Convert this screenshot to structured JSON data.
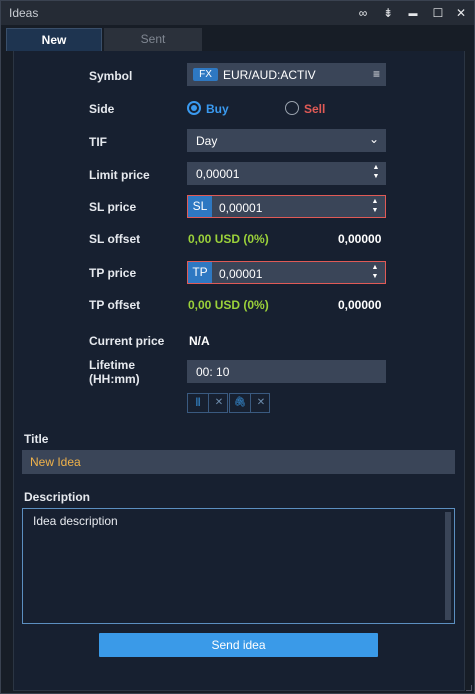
{
  "window": {
    "title": "Ideas",
    "controls": {
      "link_icon": "∞",
      "filter_icon": "⇟",
      "minimize_icon": "▬",
      "maximize_icon": "☐",
      "close_icon": "✕"
    }
  },
  "tabs": [
    {
      "label": "New",
      "active": true
    },
    {
      "label": "Sent",
      "active": false
    }
  ],
  "form": {
    "symbol": {
      "label": "Symbol",
      "badge": "FX",
      "value": "EUR/AUD:ACTIV",
      "menu_icon": "≡"
    },
    "side": {
      "label": "Side",
      "options": [
        {
          "label": "Buy",
          "selected": true,
          "color": "#3a9af0"
        },
        {
          "label": "Sell",
          "selected": false,
          "color": "#e05a56"
        }
      ]
    },
    "tif": {
      "label": "TIF",
      "value": "Day",
      "chevron": "⌄"
    },
    "limit_price": {
      "label": "Limit price",
      "value": "0,00001"
    },
    "sl_price": {
      "label": "SL price",
      "badge": "SL",
      "value": "0,00001"
    },
    "sl_offset": {
      "label": "SL offset",
      "amount": "0,00 USD (0%)",
      "value": "0,00000"
    },
    "tp_price": {
      "label": "TP price",
      "badge": "TP",
      "value": "0,00001"
    },
    "tp_offset": {
      "label": "TP offset",
      "amount": "0,00 USD (0%)",
      "value": "0,00000"
    },
    "current_price": {
      "label": "Current price",
      "value": "N/A"
    },
    "lifetime": {
      "label_line1": "Lifetime",
      "label_line2": "(HH:mm)",
      "value": "00: 10"
    }
  },
  "attachments": {
    "chart_icon": "⫴",
    "clip_icon": "🖇",
    "remove_icon": "✕"
  },
  "title_section": {
    "label": "Title",
    "value": "New Idea"
  },
  "description_section": {
    "label": "Description",
    "value": "Idea description"
  },
  "send_button": {
    "label": "Send idea"
  },
  "colors": {
    "accent": "#3a9ae8",
    "title_text": "#f0b24a",
    "offset_green": "#9bd13a",
    "error_border": "#e05a56"
  }
}
